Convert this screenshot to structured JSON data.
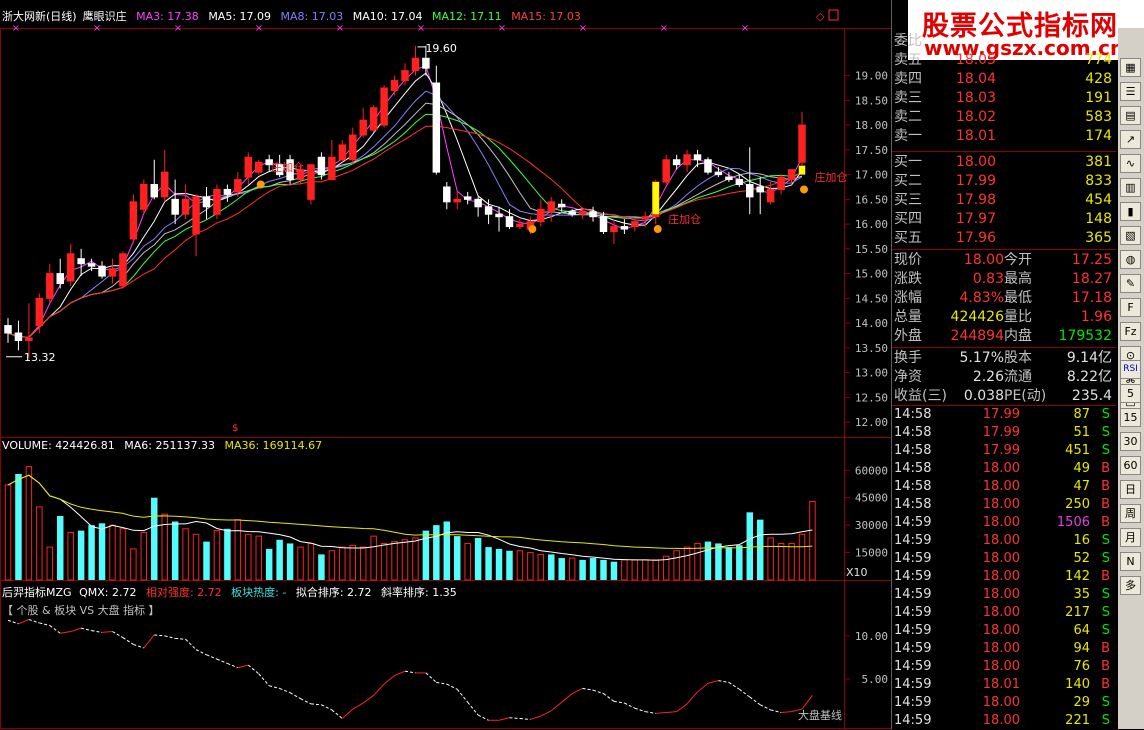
{
  "header": {
    "stock_name": "浙大网新(日线)",
    "indicator_name": "鹰眼识庄",
    "ma_labels": [
      {
        "text": "MA3: 17.38",
        "color": "#ff40ff"
      },
      {
        "text": "MA5: 17.09",
        "color": "#ffffff"
      },
      {
        "text": "MA8: 17.03",
        "color": "#8080ff"
      },
      {
        "text": "MA10: 17.04",
        "color": "#ffffff"
      },
      {
        "text": "MA12: 17.11",
        "color": "#40ff40"
      },
      {
        "text": "MA15: 17.03",
        "color": "#ff4040"
      }
    ]
  },
  "annotations": {
    "high_label": "19.60",
    "low_label": "13.32",
    "signal_text": "庄加仓",
    "signal_prefix": "大",
    "corner_label": "X10",
    "bottom_label": "大盘基线"
  },
  "volume_legend": {
    "volume": "VOLUME: 424426.81",
    "ma6": "MA6: 251137.33",
    "ma36": "MA36: 169114.67"
  },
  "indicator_legend": {
    "name": "后羿指标MZG",
    "qmx": "QMX: 2.72",
    "rel": "相对强度: 2.72",
    "heat": "板块热度: -",
    "fit": "拟合排序: 2.72",
    "slope": "斜率排序: 1.35",
    "subtitle": "【 个股 & 板块 VS 大盘 指标 】"
  },
  "banner": {
    "title": "股票公式指标网",
    "url": "www.gszx.com.cn"
  },
  "orderbook": {
    "header": "委比",
    "sells": [
      {
        "label": "卖五",
        "price": "18.05",
        "vol": "774"
      },
      {
        "label": "卖四",
        "price": "18.04",
        "vol": "428"
      },
      {
        "label": "卖三",
        "price": "18.03",
        "vol": "191"
      },
      {
        "label": "卖二",
        "price": "18.02",
        "vol": "583"
      },
      {
        "label": "卖一",
        "price": "18.01",
        "vol": "174"
      }
    ],
    "buys": [
      {
        "label": "买一",
        "price": "18.00",
        "vol": "381"
      },
      {
        "label": "买二",
        "price": "17.99",
        "vol": "833"
      },
      {
        "label": "买三",
        "price": "17.98",
        "vol": "454"
      },
      {
        "label": "买四",
        "price": "17.97",
        "vol": "148"
      },
      {
        "label": "买五",
        "price": "17.96",
        "vol": "365"
      }
    ]
  },
  "quote": [
    {
      "l1": "现价",
      "v1": "18.00",
      "c1": "red",
      "l2": "今开",
      "v2": "17.25",
      "c2": "red"
    },
    {
      "l1": "涨跌",
      "v1": "0.83",
      "c1": "red",
      "l2": "最高",
      "v2": "18.27",
      "c2": "red"
    },
    {
      "l1": "涨幅",
      "v1": "4.83%",
      "c1": "red",
      "l2": "最低",
      "v2": "17.18",
      "c2": "red"
    },
    {
      "l1": "总量",
      "v1": "424426",
      "c1": "yellow",
      "l2": "量比",
      "v2": "1.96",
      "c2": "red"
    },
    {
      "l1": "外盘",
      "v1": "244894",
      "c1": "red",
      "l2": "内盘",
      "v2": "179532",
      "c2": "green"
    }
  ],
  "fundamentals": [
    {
      "l1": "换手",
      "v1": "5.17%",
      "l2": "股本",
      "v2": "9.14亿"
    },
    {
      "l1": "净资",
      "v1": "2.26",
      "l2": "流通",
      "v2": "8.22亿"
    },
    {
      "l1": "收益(三)",
      "v1": "0.038",
      "l2": "PE(动)",
      "v2": "235.4"
    }
  ],
  "trades": [
    {
      "time": "14:58",
      "price": "17.99",
      "vol": "87",
      "bs": "S",
      "pc": "red",
      "vc": "yellow",
      "bc": "green"
    },
    {
      "time": "14:58",
      "price": "17.99",
      "vol": "51",
      "bs": "S",
      "pc": "red",
      "vc": "yellow",
      "bc": "green"
    },
    {
      "time": "14:58",
      "price": "17.99",
      "vol": "451",
      "bs": "S",
      "pc": "red",
      "vc": "yellow",
      "bc": "green"
    },
    {
      "time": "14:58",
      "price": "18.00",
      "vol": "49",
      "bs": "B",
      "pc": "red",
      "vc": "yellow",
      "bc": "red"
    },
    {
      "time": "14:58",
      "price": "18.00",
      "vol": "47",
      "bs": "B",
      "pc": "red",
      "vc": "yellow",
      "bc": "red"
    },
    {
      "time": "14:58",
      "price": "18.00",
      "vol": "250",
      "bs": "B",
      "pc": "red",
      "vc": "yellow",
      "bc": "red"
    },
    {
      "time": "14:59",
      "price": "18.00",
      "vol": "1506",
      "bs": "B",
      "pc": "red",
      "vc": "magenta",
      "bc": "red"
    },
    {
      "time": "14:59",
      "price": "18.00",
      "vol": "16",
      "bs": "S",
      "pc": "red",
      "vc": "yellow",
      "bc": "green"
    },
    {
      "time": "14:59",
      "price": "18.00",
      "vol": "52",
      "bs": "S",
      "pc": "red",
      "vc": "yellow",
      "bc": "green"
    },
    {
      "time": "14:59",
      "price": "18.00",
      "vol": "142",
      "bs": "B",
      "pc": "red",
      "vc": "yellow",
      "bc": "red"
    },
    {
      "time": "14:59",
      "price": "18.00",
      "vol": "35",
      "bs": "S",
      "pc": "red",
      "vc": "yellow",
      "bc": "green"
    },
    {
      "time": "14:59",
      "price": "18.00",
      "vol": "217",
      "bs": "S",
      "pc": "red",
      "vc": "yellow",
      "bc": "green"
    },
    {
      "time": "14:59",
      "price": "18.00",
      "vol": "64",
      "bs": "S",
      "pc": "red",
      "vc": "yellow",
      "bc": "green"
    },
    {
      "time": "14:59",
      "price": "18.00",
      "vol": "94",
      "bs": "B",
      "pc": "red",
      "vc": "yellow",
      "bc": "red"
    },
    {
      "time": "14:59",
      "price": "18.00",
      "vol": "76",
      "bs": "B",
      "pc": "red",
      "vc": "yellow",
      "bc": "red"
    },
    {
      "time": "14:59",
      "price": "18.01",
      "vol": "140",
      "bs": "B",
      "pc": "red",
      "vc": "yellow",
      "bc": "red"
    },
    {
      "time": "14:59",
      "price": "18.00",
      "vol": "29",
      "bs": "S",
      "pc": "red",
      "vc": "yellow",
      "bc": "green"
    },
    {
      "time": "14:59",
      "price": "18.00",
      "vol": "221",
      "bs": "S",
      "pc": "red",
      "vc": "yellow",
      "bc": "green"
    }
  ],
  "sidebar": {
    "buttons": [
      {
        "name": "sidebar-rsi-button",
        "label": "RSI"
      },
      {
        "name": "sidebar-5-button",
        "label": "5"
      },
      {
        "name": "sidebar-15-button",
        "label": "15"
      },
      {
        "name": "sidebar-30-button",
        "label": "30"
      },
      {
        "name": "sidebar-60-button",
        "label": "60"
      },
      {
        "name": "sidebar-day-button",
        "label": "日"
      },
      {
        "name": "sidebar-week-button",
        "label": "周"
      },
      {
        "name": "sidebar-month-button",
        "label": "月"
      },
      {
        "name": "sidebar-n-button",
        "label": "N"
      },
      {
        "name": "sidebar-more-button",
        "label": "多"
      }
    ]
  },
  "colors": {
    "up": "#ff2020",
    "down": "#ffffff",
    "volume_down": "#54fcfc",
    "grid": "#8b0000",
    "axis_text": "#c0c0c0"
  },
  "chart_data": [
    {
      "type": "candlestick",
      "title": "浙大网新(日线)",
      "yticks": [
        19.0,
        18.5,
        18.0,
        17.5,
        17.0,
        16.5,
        16.0,
        15.5,
        15.0,
        14.5,
        14.0,
        13.5,
        13.0,
        12.5,
        12.0
      ],
      "ylim": [
        11.8,
        19.8
      ],
      "candles": [
        [
          13.95,
          14.1,
          13.6,
          13.8
        ],
        [
          13.8,
          14.05,
          13.45,
          13.65
        ],
        [
          13.65,
          14.4,
          13.3,
          13.7
        ],
        [
          13.95,
          14.6,
          13.8,
          14.5
        ],
        [
          14.5,
          15.2,
          14.4,
          15.0
        ],
        [
          15.0,
          15.3,
          14.7,
          14.8
        ],
        [
          14.85,
          15.6,
          14.75,
          15.4
        ],
        [
          15.3,
          15.5,
          14.95,
          15.2
        ],
        [
          15.2,
          15.3,
          15.05,
          15.15
        ],
        [
          15.15,
          15.25,
          14.9,
          14.95
        ],
        [
          14.95,
          15.3,
          14.8,
          15.1
        ],
        [
          14.75,
          15.45,
          14.7,
          15.4
        ],
        [
          15.7,
          16.6,
          15.65,
          16.45
        ],
        [
          16.3,
          16.9,
          16.2,
          16.8
        ],
        [
          16.8,
          17.3,
          16.5,
          16.55
        ],
        [
          16.55,
          17.5,
          16.45,
          17.05
        ],
        [
          16.5,
          16.9,
          16.0,
          16.2
        ],
        [
          16.2,
          16.8,
          16.1,
          16.5
        ],
        [
          15.8,
          16.6,
          15.35,
          16.55
        ],
        [
          16.55,
          16.75,
          16.1,
          16.35
        ],
        [
          16.2,
          16.8,
          16.1,
          16.7
        ],
        [
          16.7,
          16.8,
          16.45,
          16.6
        ],
        [
          16.65,
          17.05,
          16.55,
          16.9
        ],
        [
          16.95,
          17.45,
          16.8,
          17.35
        ],
        [
          17.05,
          17.3,
          17.0,
          17.25
        ],
        [
          17.3,
          17.4,
          17.05,
          17.2
        ],
        [
          17.2,
          17.4,
          16.95,
          17.0
        ],
        [
          17.3,
          17.4,
          16.8,
          16.9
        ],
        [
          16.9,
          17.2,
          16.8,
          17.1
        ],
        [
          16.5,
          17.2,
          16.4,
          17.2
        ],
        [
          17.35,
          17.45,
          16.9,
          17.0
        ],
        [
          16.9,
          17.7,
          16.9,
          17.35
        ],
        [
          17.3,
          17.7,
          17.25,
          17.6
        ],
        [
          17.3,
          17.95,
          17.2,
          17.8
        ],
        [
          17.8,
          18.35,
          17.75,
          18.1
        ],
        [
          17.9,
          18.4,
          17.85,
          18.35
        ],
        [
          18.0,
          18.8,
          17.95,
          18.75
        ],
        [
          18.7,
          19.0,
          18.6,
          18.9
        ],
        [
          18.9,
          19.25,
          18.8,
          19.1
        ],
        [
          19.1,
          19.6,
          19.0,
          19.35
        ],
        [
          19.35,
          19.6,
          19.0,
          19.15
        ],
        [
          18.85,
          19.2,
          17.0,
          17.05
        ],
        [
          16.75,
          16.85,
          16.3,
          16.45
        ],
        [
          16.45,
          16.65,
          16.3,
          16.5
        ],
        [
          16.55,
          16.65,
          16.4,
          16.5
        ],
        [
          16.5,
          16.55,
          16.15,
          16.35
        ],
        [
          16.35,
          16.5,
          16.0,
          16.2
        ],
        [
          16.2,
          16.35,
          15.85,
          16.15
        ],
        [
          16.15,
          16.3,
          15.9,
          15.95
        ],
        [
          15.95,
          16.1,
          15.9,
          16.0
        ],
        [
          15.9,
          16.15,
          15.8,
          16.05
        ],
        [
          16.05,
          16.5,
          15.95,
          16.3
        ],
        [
          16.25,
          16.55,
          16.05,
          16.45
        ],
        [
          16.4,
          16.5,
          16.25,
          16.35
        ],
        [
          16.25,
          16.3,
          16.15,
          16.2
        ],
        [
          16.2,
          16.3,
          16.1,
          16.25
        ],
        [
          16.25,
          16.35,
          16.05,
          16.15
        ],
        [
          16.15,
          16.25,
          15.8,
          15.85
        ],
        [
          15.85,
          16.1,
          15.6,
          15.95
        ],
        [
          15.95,
          16.1,
          15.8,
          15.9
        ],
        [
          15.95,
          16.1,
          15.85,
          16.05
        ],
        [
          16.1,
          16.25,
          15.95,
          16.15
        ],
        [
          16.15,
          16.9,
          16.0,
          16.85
        ],
        [
          16.85,
          17.4,
          16.8,
          17.3
        ],
        [
          17.3,
          17.4,
          17.1,
          17.2
        ],
        [
          17.2,
          17.5,
          17.05,
          17.4
        ],
        [
          17.4,
          17.5,
          17.15,
          17.3
        ],
        [
          17.3,
          17.35,
          17.0,
          17.05
        ],
        [
          17.05,
          17.15,
          16.95,
          17.0
        ],
        [
          16.95,
          17.05,
          16.85,
          16.9
        ],
        [
          16.9,
          17.0,
          16.75,
          16.8
        ],
        [
          16.8,
          17.55,
          16.2,
          16.55
        ],
        [
          16.75,
          16.95,
          16.2,
          16.65
        ],
        [
          16.45,
          16.85,
          16.4,
          16.7
        ],
        [
          16.7,
          17.0,
          16.6,
          16.95
        ],
        [
          16.9,
          17.1,
          16.8,
          17.1
        ],
        [
          17.25,
          18.27,
          17.18,
          18.0
        ]
      ],
      "ma_lines": [
        "MA3",
        "MA5",
        "MA8",
        "MA10",
        "MA12",
        "MA15"
      ],
      "annotations": [
        "19.60",
        "13.32",
        "庄加仓"
      ]
    },
    {
      "type": "bar",
      "title": "VOLUME",
      "yticks": [
        60000,
        45000,
        30000,
        15000
      ],
      "ylim": [
        0,
        70000
      ],
      "values": [
        52000,
        58000,
        62000,
        40000,
        18000,
        35000,
        26000,
        27000,
        30000,
        31000,
        30000,
        28000,
        17000,
        26000,
        45000,
        36000,
        32000,
        28000,
        25000,
        21000,
        27000,
        28000,
        33000,
        25000,
        24000,
        17000,
        22000,
        20000,
        18000,
        20000,
        14000,
        16000,
        18000,
        19000,
        18000,
        24000,
        20000,
        21000,
        22000,
        23000,
        27000,
        30000,
        32000,
        24000,
        20000,
        23000,
        18000,
        17000,
        16000,
        16000,
        15000,
        14000,
        14000,
        12000,
        12000,
        11000,
        12000,
        11000,
        10000,
        11000,
        11000,
        11000,
        11000,
        13000,
        16000,
        18000,
        20000,
        21000,
        20000,
        18000,
        19000,
        37000,
        33000,
        23000,
        20000,
        20000,
        25000,
        43000
      ],
      "up": [
        1,
        0,
        1,
        1,
        1,
        0,
        1,
        0,
        0,
        0,
        1,
        1,
        1,
        1,
        0,
        1,
        0,
        1,
        1,
        0,
        1,
        0,
        1,
        1,
        1,
        0,
        0,
        0,
        1,
        1,
        0,
        1,
        1,
        1,
        1,
        1,
        1,
        1,
        1,
        1,
        0,
        0,
        0,
        0,
        1,
        0,
        0,
        0,
        0,
        1,
        1,
        1,
        0,
        0,
        1,
        0,
        0,
        0,
        0,
        1,
        1,
        1,
        1,
        1,
        1,
        1,
        1,
        0,
        0,
        0,
        0,
        0,
        0,
        1,
        1,
        1,
        1,
        1
      ],
      "series": [
        "VOLUME",
        "MA6",
        "MA36"
      ]
    },
    {
      "type": "line",
      "title": "后羿指标MZG",
      "yticks": [
        10.0,
        5.0
      ],
      "ylim": [
        0,
        13
      ],
      "values": [
        11.8,
        11.4,
        11.9,
        11.5,
        11.2,
        10.3,
        10.5,
        10.9,
        10.6,
        10.4,
        10.5,
        9.8,
        9.0,
        8.6,
        10.1,
        10.0,
        9.7,
        9.6,
        8.4,
        7.8,
        7.3,
        6.8,
        6.3,
        6.6,
        5.6,
        4.2,
        3.9,
        3.4,
        2.7,
        2.1,
        2.0,
        1.4,
        0.4,
        1.5,
        2.2,
        3.1,
        4.4,
        5.4,
        5.9,
        5.7,
        5.7,
        4.6,
        4.4,
        3.8,
        2.3,
        0.8,
        0.2,
        0.2,
        0.5,
        0.4,
        0.3,
        0.7,
        1.3,
        2.3,
        3.3,
        3.9,
        3.7,
        3.3,
        2.4,
        2.2,
        1.6,
        1.2,
        1.0,
        1.1,
        1.2,
        2.1,
        3.5,
        4.5,
        4.8,
        4.6,
        3.8,
        2.9,
        2.0,
        1.4,
        1.1,
        1.2,
        1.5,
        3.1
      ]
    }
  ]
}
